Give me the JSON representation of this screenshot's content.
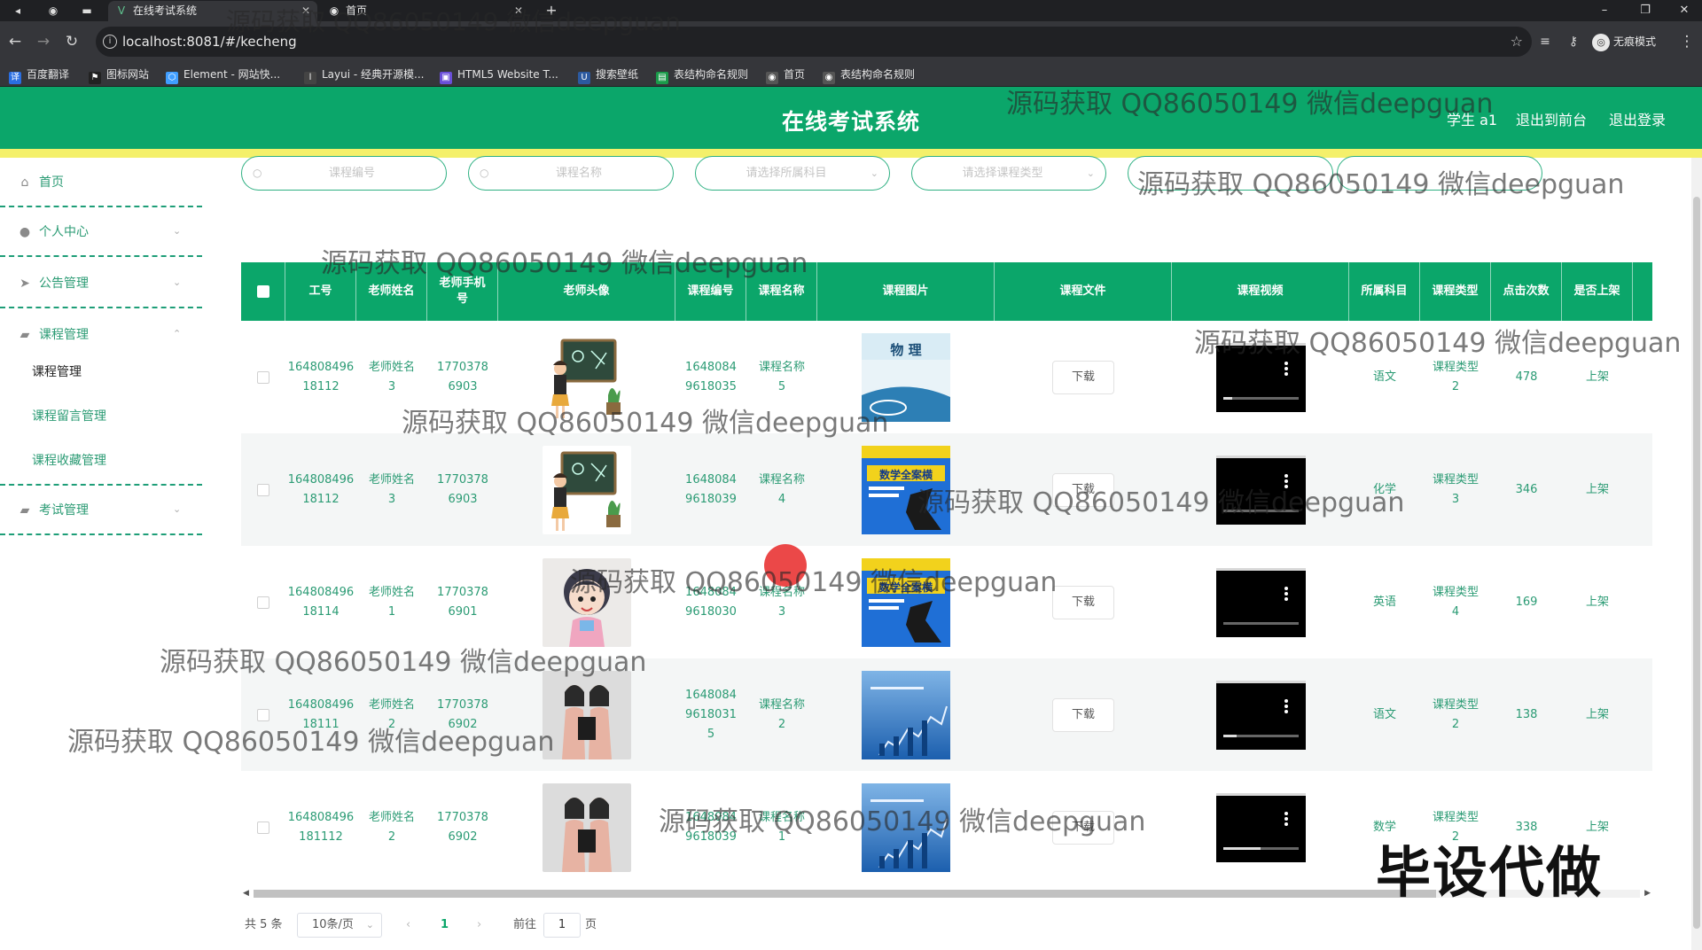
{
  "browser": {
    "tabs": [
      {
        "label": "在线考试系统",
        "active": true
      },
      {
        "label": "首页",
        "active": false
      }
    ],
    "url": "localhost:8081/#/kecheng",
    "incognito_label": "无痕模式",
    "bookmarks": [
      "百度翻译",
      "图标网站",
      "Element - 网站快...",
      "Layui - 经典开源模...",
      "HTML5 Website T...",
      "搜索壁纸",
      "表结构命名规则",
      "首页",
      "表结构命名规则"
    ]
  },
  "header": {
    "title": "在线考试系统",
    "user": "学生 a1",
    "back_front": "退出到前台",
    "logout": "退出登录"
  },
  "sidebar": {
    "items": [
      {
        "label": "首页",
        "icon": "home-icon"
      },
      {
        "label": "个人中心",
        "icon": "user-icon"
      },
      {
        "label": "公告管理",
        "icon": "send-icon"
      },
      {
        "label": "课程管理",
        "icon": "briefcase-icon"
      },
      {
        "label": "考试管理",
        "icon": "briefcase-icon"
      }
    ],
    "course_sub": [
      "课程管理",
      "课程留言管理",
      "课程收藏管理"
    ]
  },
  "search": {
    "course_no": "课程编号",
    "course_name": "课程名称",
    "subject": "请选择所属科目",
    "course_type": "请选择课程类型"
  },
  "table": {
    "headers": [
      "工号",
      "老师姓名",
      "老师手机号",
      "老师头像",
      "课程编号",
      "课程名称",
      "课程图片",
      "课程文件",
      "课程视频",
      "所属科目",
      "课程类型",
      "点击次数",
      "是否上架"
    ],
    "download_label": "下载",
    "rows": [
      {
        "job_no": "16480849618112",
        "teacher": "老师姓名3",
        "phone": "17703786903",
        "course_no": "16480849618035",
        "course_name": "课程名称5",
        "subject": "语文",
        "type": "课程类型2",
        "clicks": "478",
        "status": "上架",
        "cover_text": "物 理"
      },
      {
        "job_no": "16480849618112",
        "teacher": "老师姓名3",
        "phone": "17703786903",
        "course_no": "16480849618039",
        "course_name": "课程名称4",
        "subject": "化学",
        "type": "课程类型3",
        "clicks": "346",
        "status": "上架",
        "cover_text": "数学全案横"
      },
      {
        "job_no": "16480849618114",
        "teacher": "老师姓名1",
        "phone": "17703786901",
        "course_no": "16480849618030",
        "course_name": "课程名称3",
        "subject": "英语",
        "type": "课程类型4",
        "clicks": "169",
        "status": "上架",
        "cover_text": "数学全案横"
      },
      {
        "job_no": "16480849618111",
        "teacher": "老师姓名2",
        "phone": "17703786902",
        "course_no": "164808496180315",
        "course_name": "课程名称2",
        "subject": "语文",
        "type": "课程类型2",
        "clicks": "138",
        "status": "上架",
        "cover_text": ""
      },
      {
        "job_no": "164808496181112",
        "teacher": "老师姓名2",
        "phone": "17703786902",
        "course_no": "16480849618039",
        "course_name": "课程名称1",
        "subject": "数学",
        "type": "课程类型2",
        "clicks": "338",
        "status": "上架",
        "cover_text": ""
      }
    ]
  },
  "pagination": {
    "total": "共 5 条",
    "page_size": "10条/页",
    "current": "1",
    "goto_prefix": "前往",
    "goto_value": "1",
    "goto_suffix": "页"
  },
  "watermark": "源码获取 QQ86050149 微信deepguan",
  "stamp": "毕设代做",
  "colors": {
    "header": "#0ba66a",
    "accent_text": "#2b9b74",
    "yellow_bar": "#f4f06a"
  }
}
